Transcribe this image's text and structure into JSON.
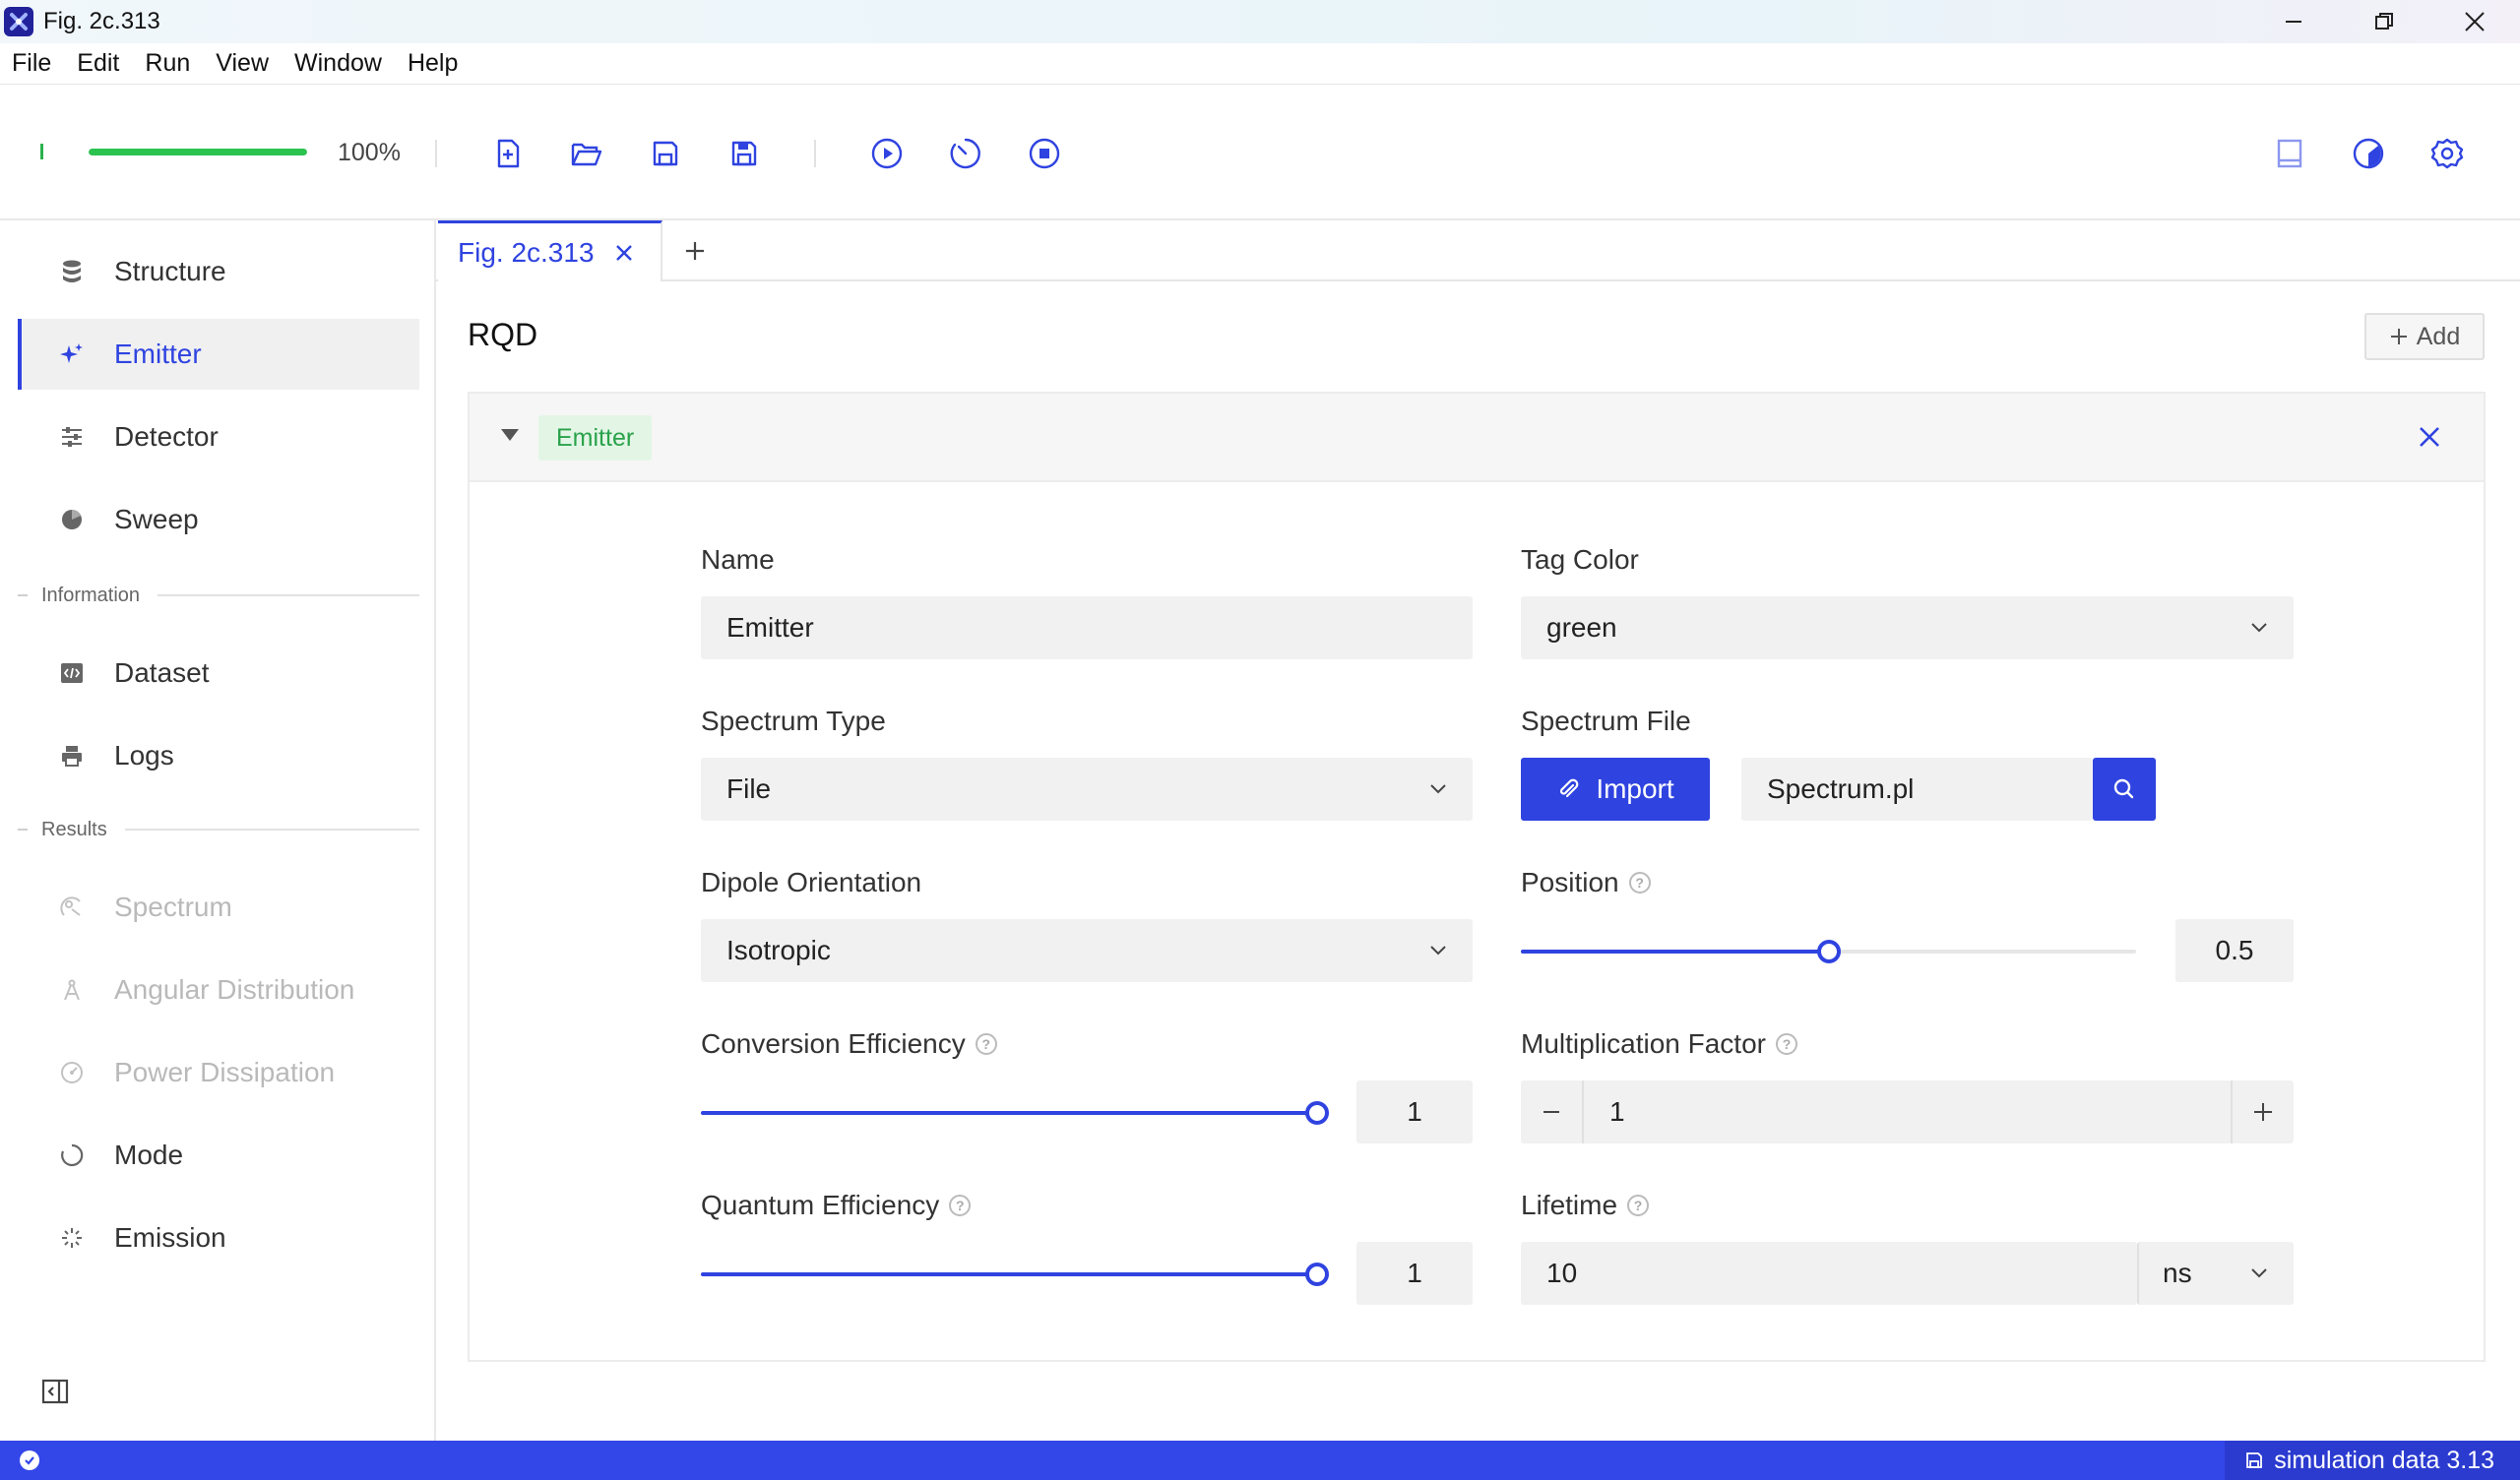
{
  "window": {
    "title": "Fig. 2c.313"
  },
  "menu": [
    "File",
    "Edit",
    "Run",
    "View",
    "Window",
    "Help"
  ],
  "toolbar": {
    "progress_percent": 100,
    "progress_label": "100%"
  },
  "sidebar": {
    "items": [
      {
        "label": "Structure",
        "icon": "database-icon"
      },
      {
        "label": "Emitter",
        "icon": "sparkles-icon",
        "active": true
      },
      {
        "label": "Detector",
        "icon": "sliders-icon"
      },
      {
        "label": "Sweep",
        "icon": "pie-icon"
      }
    ],
    "section_information": "Information",
    "info_items": [
      {
        "label": "Dataset",
        "icon": "code-icon"
      },
      {
        "label": "Logs",
        "icon": "printer-icon"
      }
    ],
    "section_results": "Results",
    "result_items": [
      {
        "label": "Spectrum",
        "icon": "spectrum-icon",
        "disabled": true
      },
      {
        "label": "Angular Distribution",
        "icon": "compass-icon",
        "disabled": true
      },
      {
        "label": "Power Dissipation",
        "icon": "gauge-icon",
        "disabled": true
      },
      {
        "label": "Mode",
        "icon": "circle-icon"
      },
      {
        "label": "Emission",
        "icon": "burst-icon"
      }
    ]
  },
  "tabs": {
    "active_label": "Fig. 2c.313"
  },
  "main": {
    "section_title": "RQD",
    "add_label": "Add",
    "card": {
      "tag": "Emitter",
      "tag_color": "#2aa24b",
      "fields": {
        "name_label": "Name",
        "name_value": "Emitter",
        "tag_color_label": "Tag Color",
        "tag_color_value": "green",
        "spectrum_type_label": "Spectrum Type",
        "spectrum_type_value": "File",
        "spectrum_file_label": "Spectrum File",
        "import_label": "Import",
        "spectrum_file_value": "Spectrum.pl",
        "dipole_label": "Dipole Orientation",
        "dipole_value": "Isotropic",
        "position_label": "Position",
        "position_value": "0.5",
        "position_fraction": 0.5,
        "conversion_label": "Conversion Efficiency",
        "conversion_value": "1",
        "conversion_fraction": 1.0,
        "multiplication_label": "Multiplication Factor",
        "multiplication_value": "1",
        "quantum_label": "Quantum Efficiency",
        "quantum_value": "1",
        "quantum_fraction": 1.0,
        "lifetime_label": "Lifetime",
        "lifetime_value": "10",
        "lifetime_unit": "ns"
      }
    }
  },
  "status": {
    "right_label": "simulation data 3.13"
  },
  "colors": {
    "accent": "#2f43e0",
    "success": "#2bc34e",
    "statusbar": "#3346e8"
  }
}
